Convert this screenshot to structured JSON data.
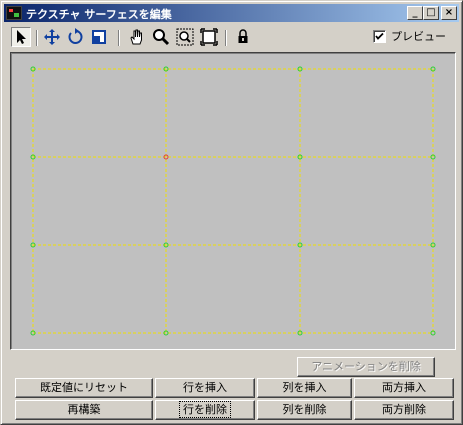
{
  "window": {
    "title": "テクスチャ サーフェスを編集",
    "title_buttons": [
      "_",
      "□",
      "×"
    ]
  },
  "toolbar": {
    "tools": [
      {
        "icon": "select-arrow-icon",
        "active": true
      },
      {
        "icon": "move-icon"
      },
      {
        "icon": "rotate-icon"
      },
      {
        "icon": "scale-icon"
      },
      {
        "icon": "pan-hand-icon"
      },
      {
        "icon": "zoom-icon"
      },
      {
        "icon": "zoom-region-icon"
      },
      {
        "icon": "zoom-extents-icon"
      },
      {
        "icon": "lock-icon"
      }
    ],
    "preview": {
      "label": "プレビュー",
      "checked": true
    }
  },
  "viewport": {
    "grid_color": "#f0e000",
    "point_color": "#30d030",
    "selected_point_color": "#e04040",
    "background": "#c0c0c0"
  },
  "buttons": {
    "delete_animation": "アニメーションを削除",
    "reset_default": "既定値にリセット",
    "rebuild": "再構築",
    "insert_row": "行を挿入",
    "delete_row": "行を削除",
    "insert_column": "列を挿入",
    "delete_column": "列を削除",
    "insert_both": "両方挿入",
    "delete_both": "両方削除"
  }
}
